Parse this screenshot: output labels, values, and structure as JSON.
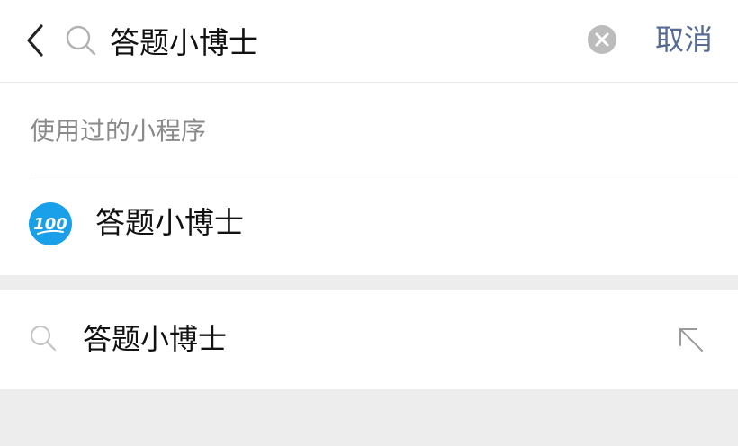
{
  "search": {
    "query": "答题小博士",
    "cancel_label": "取消"
  },
  "mini_programs": {
    "section_title": "使用过的小程序",
    "items": [
      {
        "name": "答题小博士",
        "icon": "100-score-badge",
        "icon_text": "100"
      }
    ]
  },
  "suggestions": [
    {
      "text": "答题小博士",
      "icon": "search-icon",
      "action_icon": "fill-arrow-icon"
    }
  ],
  "colors": {
    "link": "#576b95",
    "page_bg": "#ededed",
    "logo_blue": "#1aa0e8"
  }
}
